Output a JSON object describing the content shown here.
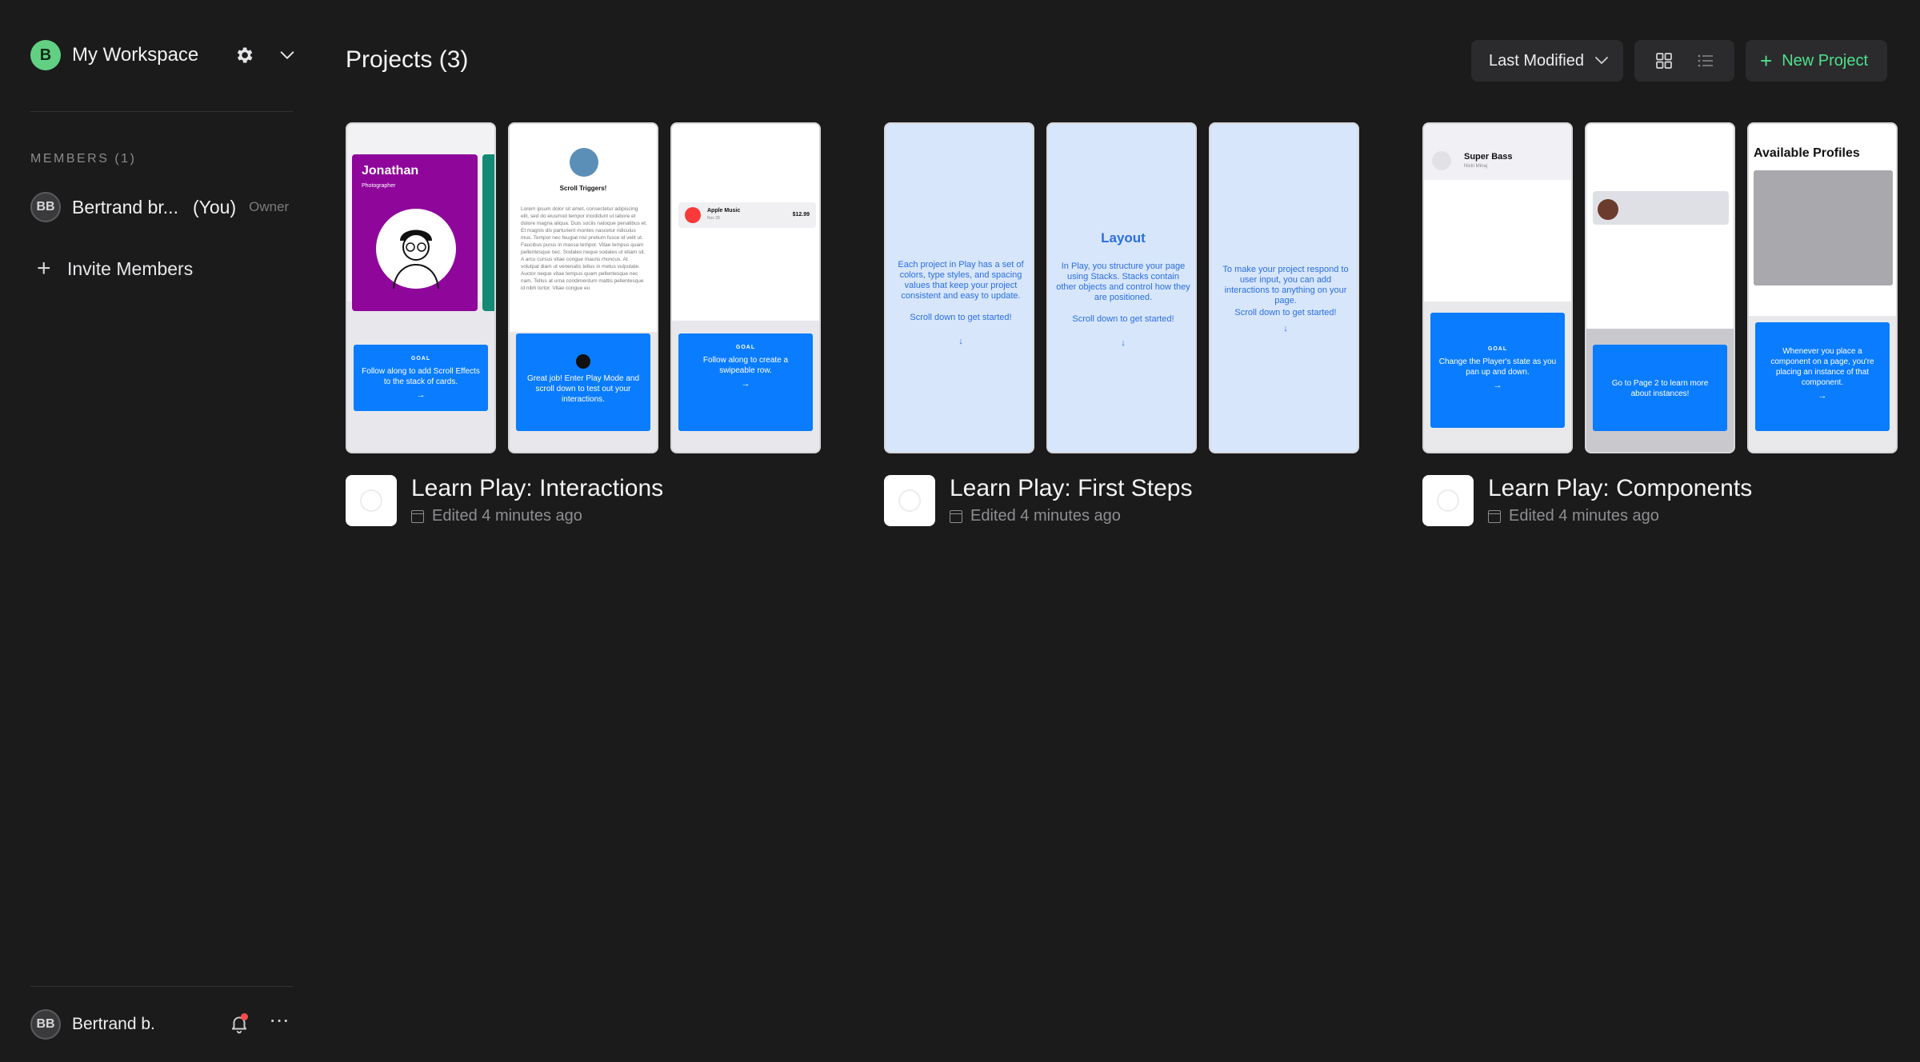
{
  "sidebar": {
    "workspace": {
      "avatar": "B",
      "name": "My Workspace",
      "settings_icon": "gear-icon",
      "menu_icon": "chevron-down-icon"
    },
    "members_heading": "MEMBERS (1)",
    "members": [
      {
        "initials": "BB",
        "name": "Bertrand br...",
        "you": "(You)",
        "role": "Owner"
      }
    ],
    "invite_label": "Invite Members",
    "current_user": {
      "initials": "BB",
      "name": "Bertrand b."
    }
  },
  "header": {
    "title": "Projects (3)",
    "sort_label": "Last Modified",
    "new_project_label": "New Project"
  },
  "colors": {
    "accent": "#4fe08a",
    "background": "#1b1b1c",
    "goal_blue": "#0a7cff",
    "workspace_avatar": "#62d083"
  },
  "projects": [
    {
      "title": "Learn Play: Interactions",
      "edited": "Edited 4 minutes ago",
      "thumbs": {
        "card_name": "Jonathan",
        "card_sub": "Photographer",
        "scroll_title": "Scroll Triggers!",
        "lorem": "Lorem ipsum dolor sit amet, consectetur adipiscing elit, sed do eiusmod tempor incididunt ut labore et dolore magna aliqua. Duis sociis natoque penatibus et. Et magnis dis parturient montes nascetur ridiculus mus. Tempor nec feugiat nisl pretium fusce id velit ut. Faucibus purus in massa tempor. Vitae tempus quam pellentesque nec. Sodales neque sodales ut etiam sit. A arcu cursus vitae congue mauris rhoncus. At volutpat diam ut venenatis tellus in metus vulputate. Auctor neque vitae tempus quam pellentesque nec nam. Tellus at urna condimentum mattis pellentesque id nibh tortor. Vitae congue eu",
        "music_name": "Apple Music",
        "music_sub": "Nov 28",
        "music_price": "$12.99",
        "goal_label": "GOAL",
        "goal_1": "Follow along to add Scroll Effects to the stack of cards.",
        "goal_2": "Great job! Enter Play Mode and scroll down to test out your interactions.",
        "goal_3": "Follow along to create a swipeable row.",
        "arrow": "→"
      }
    },
    {
      "title": "Learn Play: First Steps",
      "edited": "Edited 4 minutes ago",
      "thumbs": {
        "text_1": "Each project in Play has a set of colors, type styles, and spacing values that keep your project consistent and easy to update.",
        "layout_heading": "Layout",
        "text_2": "In Play, you structure your page using Stacks. Stacks contain other objects and control how they are positioned.",
        "text_3": "To make your project respond to user input, you can add interactions to anything on your page.",
        "scroll_hint": "Scroll down to get started!",
        "down_arrow": "↓"
      }
    },
    {
      "title": "Learn Play: Components",
      "edited": "Edited 4 minutes ago",
      "thumbs": {
        "player_name": "Super Bass",
        "player_sub": "Nicki Minaj",
        "goal_label": "GOAL",
        "goal_1": "Change the Player's state as you pan up and down.",
        "goal_2": "Go to Page 2 to learn more about instances!",
        "profiles_heading": "Available Profiles",
        "goal_3": "Whenever you place a component on a page, you're placing an instance of that component.",
        "arrow": "→"
      }
    }
  ]
}
